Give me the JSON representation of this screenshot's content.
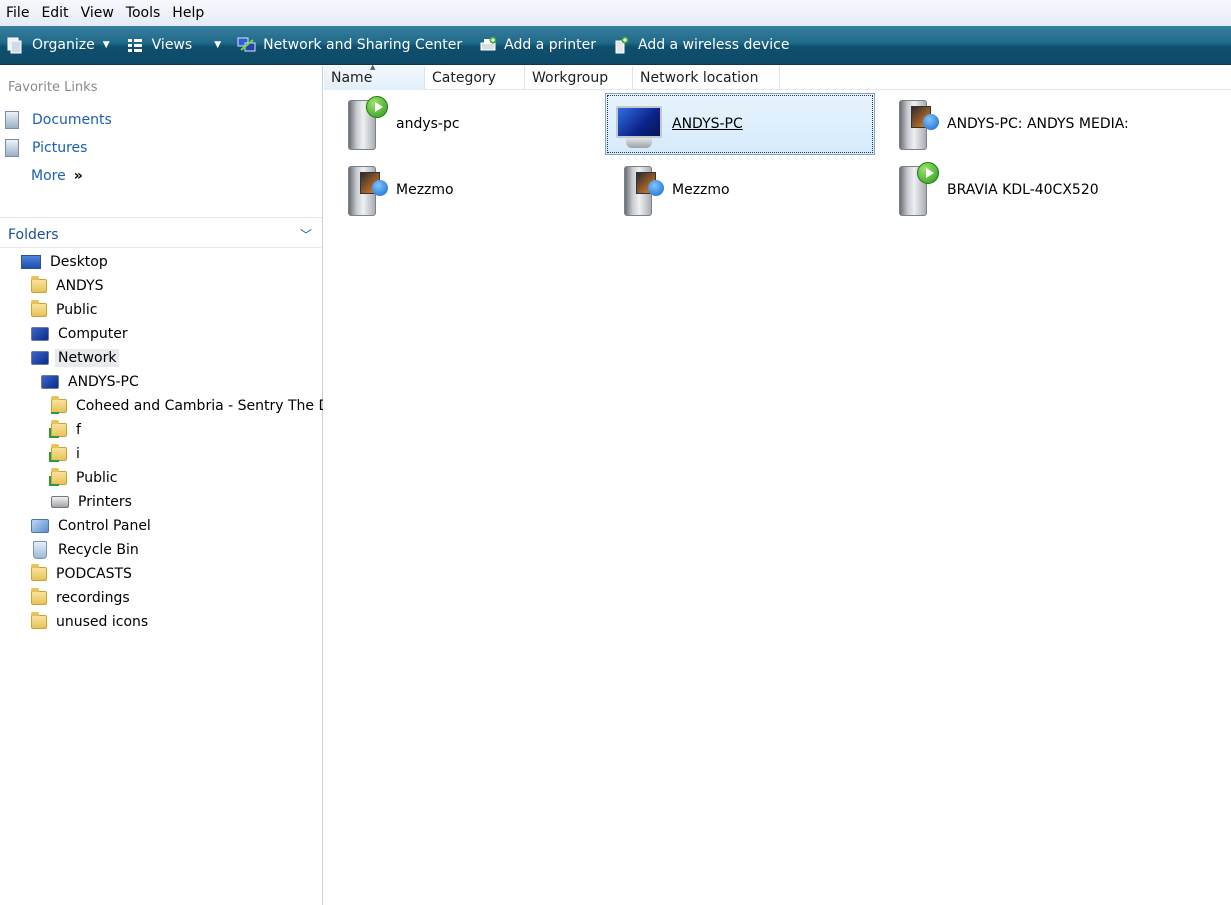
{
  "menu": [
    "File",
    "Edit",
    "View",
    "Tools",
    "Help"
  ],
  "toolbar": {
    "organize": "Organize",
    "views": "Views",
    "network_center": "Network and Sharing Center",
    "add_printer": "Add a printer",
    "add_wireless": "Add a wireless device"
  },
  "favorites": {
    "title": "Favorite Links",
    "items": [
      "Documents",
      "Pictures",
      "More"
    ]
  },
  "folders": {
    "title": "Folders",
    "tree": [
      "Desktop",
      "ANDYS",
      "Public",
      "Computer",
      "Network",
      "ANDYS-PC",
      "Coheed and Cambria - Sentry The De",
      "f",
      "i",
      "Public",
      "Printers",
      "Control Panel",
      "Recycle Bin",
      "PODCASTS",
      "recordings",
      "unused icons"
    ]
  },
  "columns": [
    "Name",
    "Category",
    "Workgroup",
    "Network location"
  ],
  "devices": [
    {
      "label": "andys-pc",
      "icon": "media-player-device-icon"
    },
    {
      "label": "ANDYS-PC",
      "icon": "computer-icon"
    },
    {
      "label": "ANDYS-PC: ANDYS MEDIA:",
      "icon": "media-server-icon"
    },
    {
      "label": "Mezzmo",
      "icon": "media-server-icon"
    },
    {
      "label": "Mezzmo",
      "icon": "media-server-icon"
    },
    {
      "label": "BRAVIA KDL-40CX520",
      "icon": "media-player-device-icon"
    }
  ],
  "colors": {
    "toolbar": "#1e6888",
    "link": "#1a5fb4",
    "selection": "#d5eafb"
  }
}
